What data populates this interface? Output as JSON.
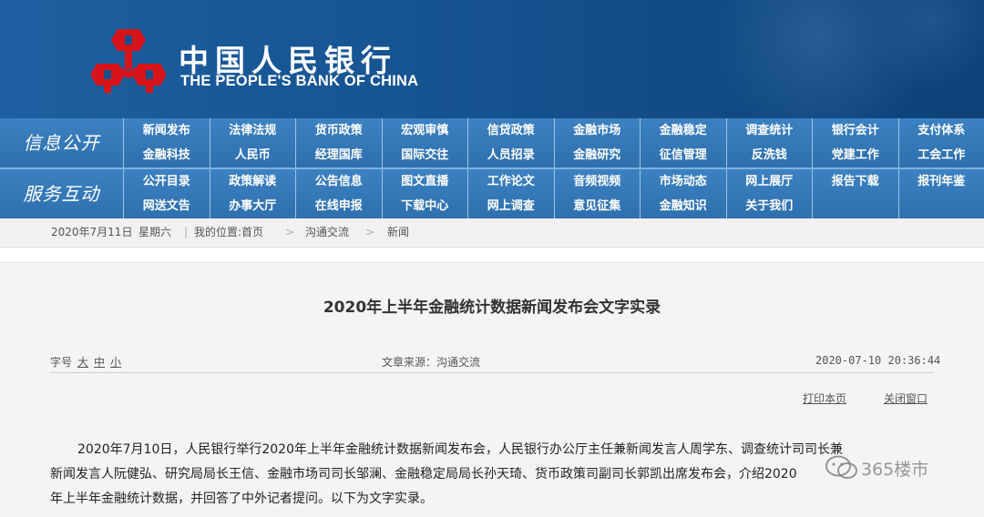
{
  "header": {
    "bank_name_cn": "中国人民银行",
    "bank_name_en": "THE PEOPLE'S BANK OF CHINA"
  },
  "nav": {
    "section1_title": "信息公开",
    "section1_items": [
      "新闻发布",
      "法律法规",
      "货币政策",
      "宏观审慎",
      "信贷政策",
      "金融市场",
      "金融稳定",
      "调查统计",
      "银行会计",
      "支付体系",
      "金融科技",
      "人民币",
      "经理国库",
      "国际交往",
      "人员招录",
      "金融研究",
      "征信管理",
      "反洗钱",
      "党建工作",
      "工会工作"
    ],
    "section2_title": "服务互动",
    "section2_items": [
      "公开目录",
      "政策解读",
      "公告信息",
      "图文直播",
      "工作论文",
      "音频视频",
      "市场动态",
      "网上展厅",
      "报告下载",
      "报刊年鉴",
      "网送文告",
      "办事大厅",
      "在线申报",
      "下载中心",
      "网上调查",
      "意见征集",
      "金融知识",
      "关于我们",
      "",
      ""
    ]
  },
  "breadcrumb": {
    "date": "2020年7月11日",
    "weekday": "星期六",
    "location_label": "我的位置:首页",
    "level1": "沟通交流",
    "level2": "新闻",
    "chevron": ">"
  },
  "article": {
    "title": "2020年上半年金融统计数据新闻发布会文字实录",
    "font_size_label": "字号",
    "font_size_large": "大",
    "font_size_medium": "中",
    "font_size_small": "小",
    "source": "文章来源：沟通交流",
    "datetime": "2020-07-10 20:36:44",
    "print_label": "打印本页",
    "close_label": "关闭窗口",
    "body_line1": "2020年7月10日，人民银行举行2020年上半年金融统计数据新闻发布会，人民银行办公厅主任兼新闻发言人周学东、调查统计司司长兼",
    "body_line2": "新闻发言人阮健弘、研究局局长王信、金融市场司司长邹澜、金融稳定局局长孙天琦、货币政策司副司长郭凯出席发布会，介绍2020",
    "body_line3": "年上半年金融统计数据，并回答了中外记者提问。以下为文字实录。"
  },
  "watermark": {
    "text": "365楼市"
  },
  "colors": {
    "header_blue": "#14508d",
    "nav_blue": "#2e70ae",
    "emblem_red": "#d7141a"
  }
}
